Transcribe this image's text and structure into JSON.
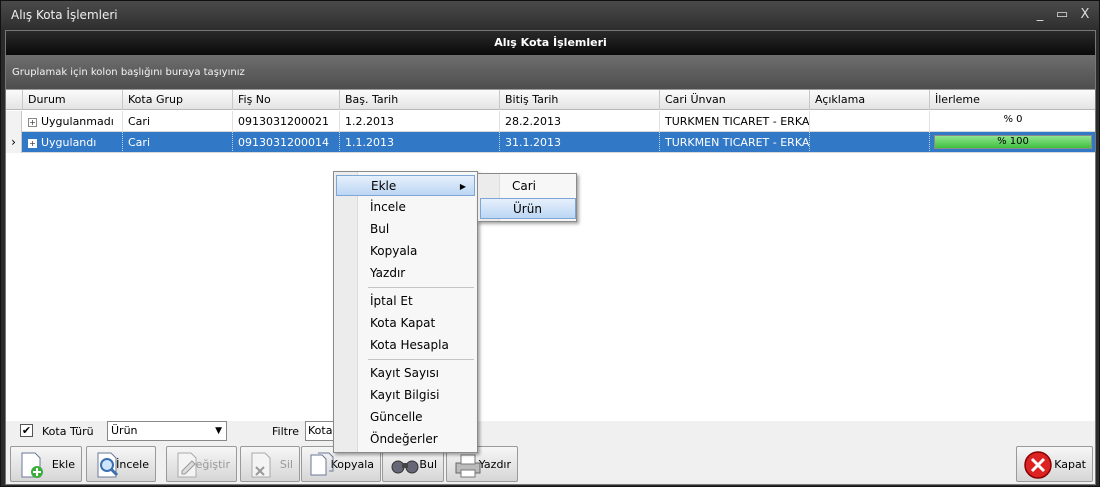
{
  "window": {
    "title": "Alış Kota İşlemleri",
    "controls": {
      "minimize": "_",
      "maximize": "▭",
      "close": "X"
    }
  },
  "panel": {
    "header": "Alış Kota İşlemleri",
    "group_hint": "Gruplamak için kolon başlığını buraya taşıyınız"
  },
  "grid": {
    "columns": [
      "Durum",
      "Kota Grup",
      "Fiş No",
      "Baş. Tarih",
      "Bitiş Tarih",
      "Cari Ünvan",
      "Açıklama",
      "İlerleme"
    ],
    "rows": [
      {
        "durum": "Uygulanmadı",
        "kota_grup": "Cari",
        "fis_no": "0913031200021",
        "bas_tarih": "1.2.2013",
        "bitis_tarih": "28.2.2013",
        "cari_unvan": "TURKMEN TICARET - ERKA...",
        "aciklama": "",
        "ilerleme": "% 0",
        "progress": 0,
        "selected": false
      },
      {
        "durum": "Uygulandı",
        "kota_grup": "Cari",
        "fis_no": "0913031200014",
        "bas_tarih": "1.1.2013",
        "bitis_tarih": "31.1.2013",
        "cari_unvan": "TURKMEN TICARET - ERKA...",
        "aciklama": "",
        "ilerleme": "% 100",
        "progress": 1,
        "selected": true
      }
    ],
    "row_indicator": "›"
  },
  "filter": {
    "kota_turu_label": "Kota Türü",
    "kota_turu_checked": "✔",
    "kota_turu_value": "Ürün",
    "filtre_label": "Filtre",
    "filtre_value": "Kotal"
  },
  "toolbar": {
    "ekle": "Ekle",
    "incele": "İncele",
    "degistir": "Değiştir",
    "sil": "Sil",
    "kopyala": "Kopyala",
    "bul": "Bul",
    "yazdir": "Yazdır",
    "kapat": "Kapat"
  },
  "context_menu": {
    "items": [
      "Ekle",
      "İncele",
      "Bul",
      "Kopyala",
      "Yazdır",
      "İptal Et",
      "Kota Kapat",
      "Kota Hesapla",
      "Kayıt Sayısı",
      "Kayıt Bilgisi",
      "Güncelle",
      "Öndeğerler"
    ],
    "submenu": [
      "Cari",
      "Ürün"
    ]
  },
  "colors": {
    "selection": "#3178c6",
    "progress": "#3fbf3f",
    "menu_highlight": "#bcd6f4"
  }
}
